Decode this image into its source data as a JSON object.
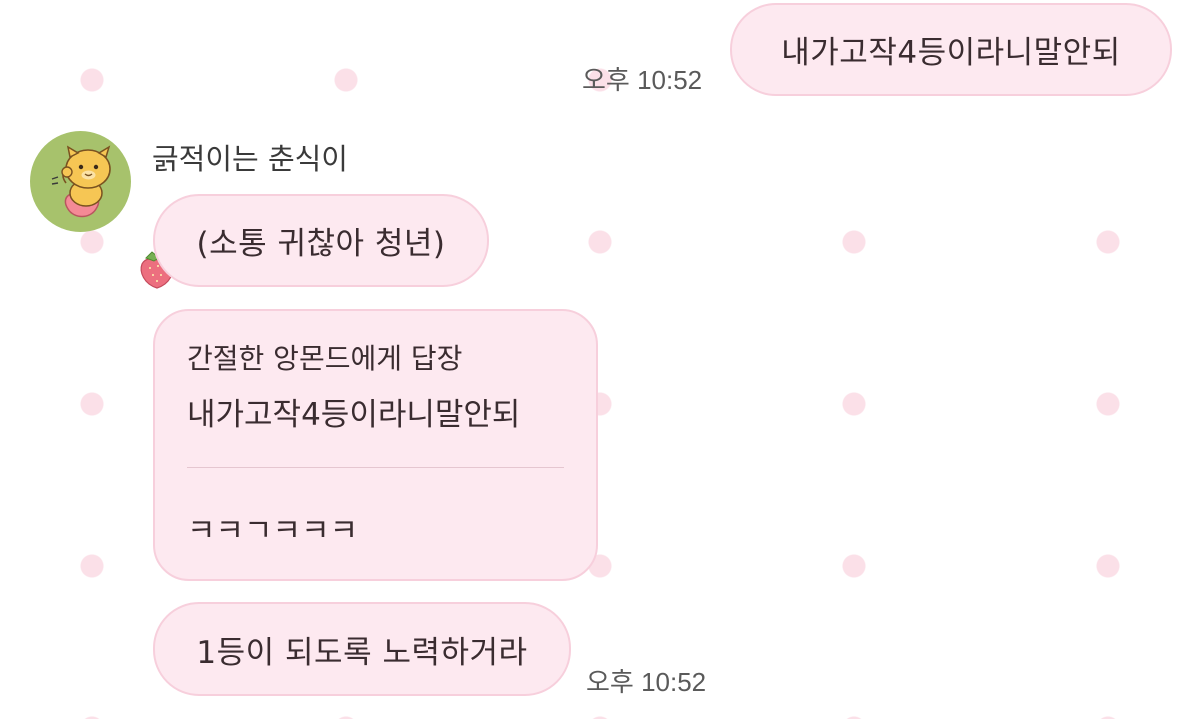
{
  "messages": {
    "sent": {
      "text": "내가고작4등이라니말안되",
      "time": "오후 10:52"
    },
    "sender": {
      "name": "긁적이는 춘식이"
    },
    "received_1": {
      "text": "(소통 귀찮아 청년)"
    },
    "reply": {
      "quote_header": "간절한 앙몬드에게 답장",
      "quote_text": "내가고작4등이라니말안되",
      "text": "ㅋㅋㄱㅋㅋㅋ"
    },
    "received_2": {
      "text": "1등이 되도록 노력하거라",
      "time": "오후 10:52"
    }
  },
  "icons": {
    "avatar": "choonsik-character-icon",
    "badge": "strawberry-icon"
  },
  "colors": {
    "background": "#ffffff",
    "polka_dot": "#fbe0e8",
    "bubble_fill": "#fde9f0",
    "bubble_border": "#f7cfdc",
    "avatar_bg": "#a7c26c",
    "text": "#3a2c30",
    "timestamp": "#5a5a5a"
  }
}
